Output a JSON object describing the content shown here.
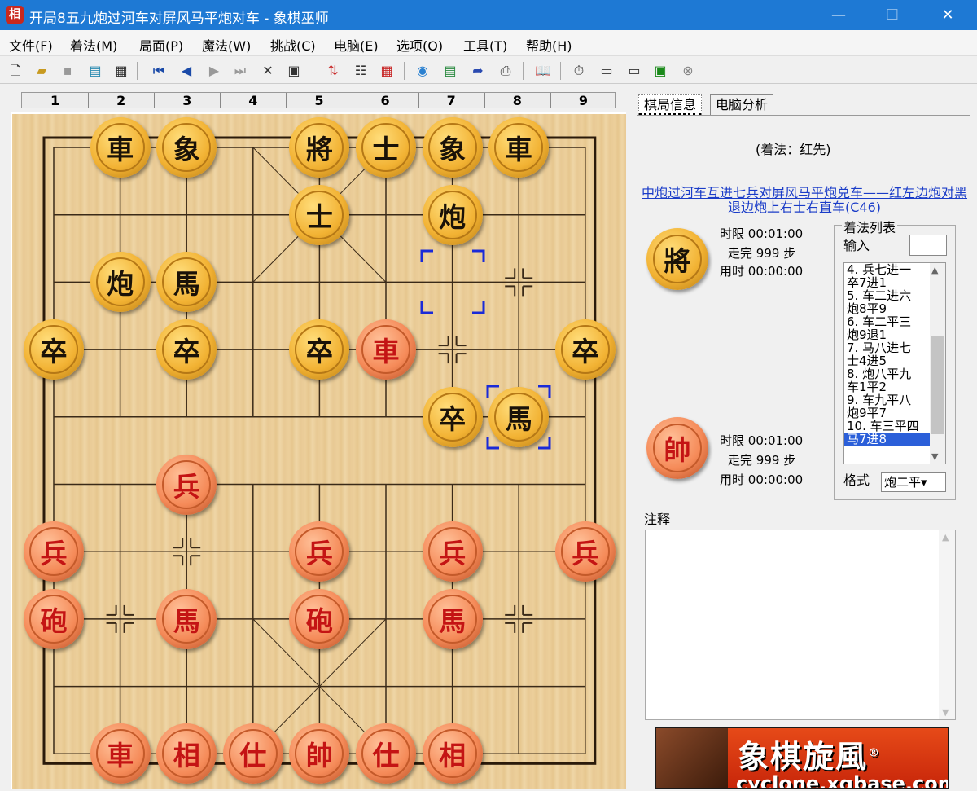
{
  "window": {
    "icon_char": "相",
    "title": "开局8五九炮过河车对屏风马平炮对车 - 象棋巫师",
    "minimize": "—",
    "maximize": "☐",
    "close": "✕"
  },
  "menu": [
    "文件(F)",
    "着法(M)",
    "局面(P)",
    "魔法(W)",
    "挑战(C)",
    "电脑(E)",
    "选项(O)",
    "工具(T)",
    "帮助(H)"
  ],
  "toolbar_icons": [
    "new-file-icon",
    "open-folder-icon",
    "save-icon",
    "notebook-icon",
    "properties-icon",
    "first-move-icon",
    "prev-move-icon",
    "next-move-icon",
    "last-move-icon",
    "delete-icon",
    "paste-icon",
    "swap-icon",
    "tree-icon",
    "board-edit-icon",
    "color-wheel-icon",
    "analyze-icon",
    "export-icon",
    "print-icon",
    "book-icon",
    "timer-icon",
    "engine1-icon",
    "engine2-icon",
    "chart-icon",
    "stop-icon"
  ],
  "ruler_top": [
    "1",
    "2",
    "3",
    "4",
    "5",
    "6",
    "7",
    "8",
    "9"
  ],
  "board": {
    "pieces": [
      {
        "t": "車",
        "c": "black",
        "f": 1,
        "r": 0
      },
      {
        "t": "象",
        "c": "black",
        "f": 2,
        "r": 0
      },
      {
        "t": "將",
        "c": "black",
        "f": 4,
        "r": 0
      },
      {
        "t": "士",
        "c": "black",
        "f": 5,
        "r": 0
      },
      {
        "t": "象",
        "c": "black",
        "f": 6,
        "r": 0
      },
      {
        "t": "車",
        "c": "black",
        "f": 7,
        "r": 0
      },
      {
        "t": "士",
        "c": "black",
        "f": 4,
        "r": 1
      },
      {
        "t": "炮",
        "c": "black",
        "f": 6,
        "r": 1
      },
      {
        "t": "炮",
        "c": "black",
        "f": 1,
        "r": 2
      },
      {
        "t": "馬",
        "c": "black",
        "f": 2,
        "r": 2
      },
      {
        "t": "卒",
        "c": "black",
        "f": 0,
        "r": 3
      },
      {
        "t": "卒",
        "c": "black",
        "f": 2,
        "r": 3
      },
      {
        "t": "卒",
        "c": "black",
        "f": 4,
        "r": 3
      },
      {
        "t": "車",
        "c": "red",
        "f": 5,
        "r": 3
      },
      {
        "t": "卒",
        "c": "black",
        "f": 8,
        "r": 3
      },
      {
        "t": "卒",
        "c": "black",
        "f": 6,
        "r": 4
      },
      {
        "t": "馬",
        "c": "black",
        "f": 7,
        "r": 4
      },
      {
        "t": "兵",
        "c": "red",
        "f": 2,
        "r": 5
      },
      {
        "t": "兵",
        "c": "red",
        "f": 0,
        "r": 6
      },
      {
        "t": "兵",
        "c": "red",
        "f": 4,
        "r": 6
      },
      {
        "t": "兵",
        "c": "red",
        "f": 6,
        "r": 6
      },
      {
        "t": "兵",
        "c": "red",
        "f": 8,
        "r": 6
      },
      {
        "t": "砲",
        "c": "red",
        "f": 0,
        "r": 7
      },
      {
        "t": "馬",
        "c": "red",
        "f": 2,
        "r": 7
      },
      {
        "t": "砲",
        "c": "red",
        "f": 4,
        "r": 7
      },
      {
        "t": "馬",
        "c": "red",
        "f": 6,
        "r": 7
      },
      {
        "t": "車",
        "c": "red",
        "f": 1,
        "r": 9
      },
      {
        "t": "相",
        "c": "red",
        "f": 2,
        "r": 9
      },
      {
        "t": "仕",
        "c": "red",
        "f": 3,
        "r": 9
      },
      {
        "t": "帥",
        "c": "red",
        "f": 4,
        "r": 9
      },
      {
        "t": "仕",
        "c": "red",
        "f": 5,
        "r": 9
      },
      {
        "t": "相",
        "c": "red",
        "f": 6,
        "r": 9
      }
    ],
    "last_move_from": {
      "f": 6,
      "r": 2
    },
    "last_move_to": {
      "f": 7,
      "r": 4
    }
  },
  "tabs": [
    "棋局信息",
    "电脑分析"
  ],
  "info": {
    "move_turn": "(着法：红先)",
    "opening": "中炮过河车互进七兵对屏风马平炮兑车——红左边炮对黑退边炮上右士右直车(C46)",
    "black": {
      "piece": "將",
      "limit_label": "时限",
      "limit": "00:01:00",
      "moves_label": "走完",
      "moves": "999",
      "moves_unit": "步",
      "used_label": "用时",
      "used": "00:00:00"
    },
    "red": {
      "piece": "帥",
      "limit_label": "时限",
      "limit": "00:01:00",
      "moves_label": "走完",
      "moves": "999",
      "moves_unit": "步",
      "used_label": "用时",
      "used": "00:00:00"
    }
  },
  "movelist": {
    "title": "着法列表",
    "input_label": "输入",
    "lines": [
      {
        "text": "4. 兵七进一",
        "sel": false
      },
      {
        "text": "   卒7进1",
        "sel": false
      },
      {
        "text": "5. 车二进六",
        "sel": false
      },
      {
        "text": "   炮8平9",
        "sel": false
      },
      {
        "text": "6. 车二平三",
        "sel": false
      },
      {
        "text": "   炮9退1",
        "sel": false
      },
      {
        "text": "7. 马八进七",
        "sel": false
      },
      {
        "text": "   士4进5",
        "sel": false
      },
      {
        "text": "8. 炮八平九",
        "sel": false
      },
      {
        "text": "   车1平2",
        "sel": false
      },
      {
        "text": "9. 车九平八",
        "sel": false
      },
      {
        "text": "   炮9平7",
        "sel": false
      },
      {
        "text": "10. 车三平四",
        "sel": false
      },
      {
        "text": "   马7进8",
        "sel": true
      }
    ],
    "format_label": "格式",
    "format_value": "炮二平▾"
  },
  "notes_label": "注释",
  "banner": {
    "title": "象棋旋風",
    "reg": "®",
    "url": "cyclone.xqbase.com"
  }
}
